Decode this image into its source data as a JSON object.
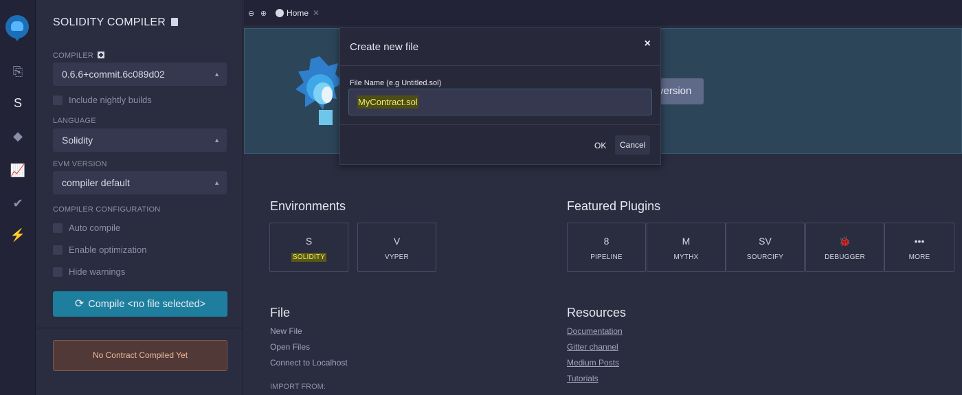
{
  "tab": {
    "zoom_out": "🔍",
    "zoom_in": "🔍",
    "label": "Home",
    "close": "✕"
  },
  "sidebar": {
    "icons": [
      "files-icon",
      "solidity-icon",
      "deploy-icon",
      "analysis-icon",
      "verify-icon",
      "plugin-icon"
    ]
  },
  "panel": {
    "title": "SOLIDITY COMPILER",
    "compiler_label": "COMPILER",
    "compiler_value": "0.6.6+commit.6c089d02",
    "nightly_label": "Include nightly builds",
    "language_label": "LANGUAGE",
    "language_value": "Solidity",
    "evm_label": "EVM VERSION",
    "evm_value": "compiler default",
    "config_label": "COMPILER CONFIGURATION",
    "auto_compile": "Auto compile",
    "enable_optimization": "Enable optimization",
    "hide_warnings": "Hide warnings",
    "compile_button": "Compile <no file selected>",
    "no_contract": "No Contract Compiled Yet"
  },
  "home": {
    "version_button": "version",
    "environments_title": "Environments",
    "environments": [
      {
        "label": "SOLIDITY",
        "icon": "S"
      },
      {
        "label": "VYPER",
        "icon": "V"
      }
    ],
    "plugins_title": "Featured Plugins",
    "plugins": [
      {
        "label": "PIPELINE",
        "icon": "8"
      },
      {
        "label": "MYTHX",
        "icon": "M"
      },
      {
        "label": "SOURCIFY",
        "icon": "SV"
      },
      {
        "label": "DEBUGGER",
        "icon": "🐞"
      },
      {
        "label": "MORE",
        "icon": "•••"
      }
    ],
    "file_title": "File",
    "file_links": [
      "New File",
      "Open Files",
      "Connect to Localhost"
    ],
    "import_from": "IMPORT FROM:",
    "resources_title": "Resources",
    "resource_links": [
      "Documentation",
      "Gitter channel",
      "Medium Posts",
      "Tutorials"
    ]
  },
  "modal": {
    "title": "Create new file",
    "close": "×",
    "field_label": "File Name (e.g Untitled.sol)",
    "field_value": "MyContract.sol",
    "ok": "OK",
    "cancel": "Cancel"
  }
}
